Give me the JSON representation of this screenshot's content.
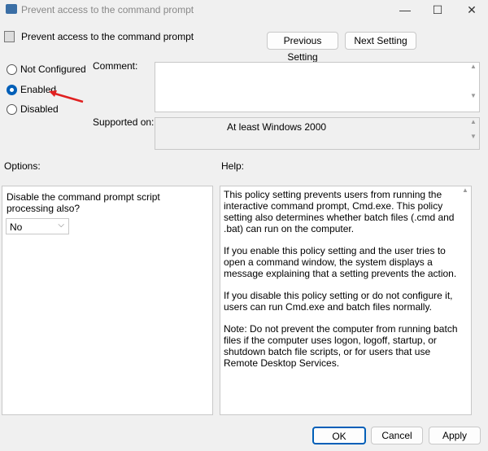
{
  "window": {
    "title": "Prevent access to the command prompt",
    "minimize": "—",
    "maximize": "☐",
    "close": "✕"
  },
  "header": {
    "policy_name": "Prevent access to the command prompt",
    "prev": "Previous Setting",
    "next": "Next Setting"
  },
  "state": {
    "options": [
      "Not Configured",
      "Enabled",
      "Disabled"
    ],
    "selected": "Enabled"
  },
  "comment": {
    "label": "Comment:",
    "value": ""
  },
  "supported": {
    "label": "Supported on:",
    "value": "At least Windows 2000"
  },
  "options": {
    "label": "Options:",
    "question": "Disable the command prompt script processing also?",
    "select_value": "No"
  },
  "help": {
    "label": "Help:",
    "paragraphs": [
      "This policy setting prevents users from running the interactive command prompt, Cmd.exe.  This policy setting also determines whether batch files (.cmd and .bat) can run on the computer.",
      "If you enable this policy setting and the user tries to open a command window, the system displays a message explaining that a setting prevents the action.",
      "If you disable this policy setting or do not configure it, users can run Cmd.exe and batch files normally.",
      "Note: Do not prevent the computer from running batch files if the computer uses logon, logoff, startup, or shutdown batch file scripts, or for users that use Remote Desktop Services."
    ]
  },
  "footer": {
    "ok": "OK",
    "cancel": "Cancel",
    "apply": "Apply"
  },
  "colors": {
    "accent": "#005fb8",
    "arrow": "#e02020"
  }
}
